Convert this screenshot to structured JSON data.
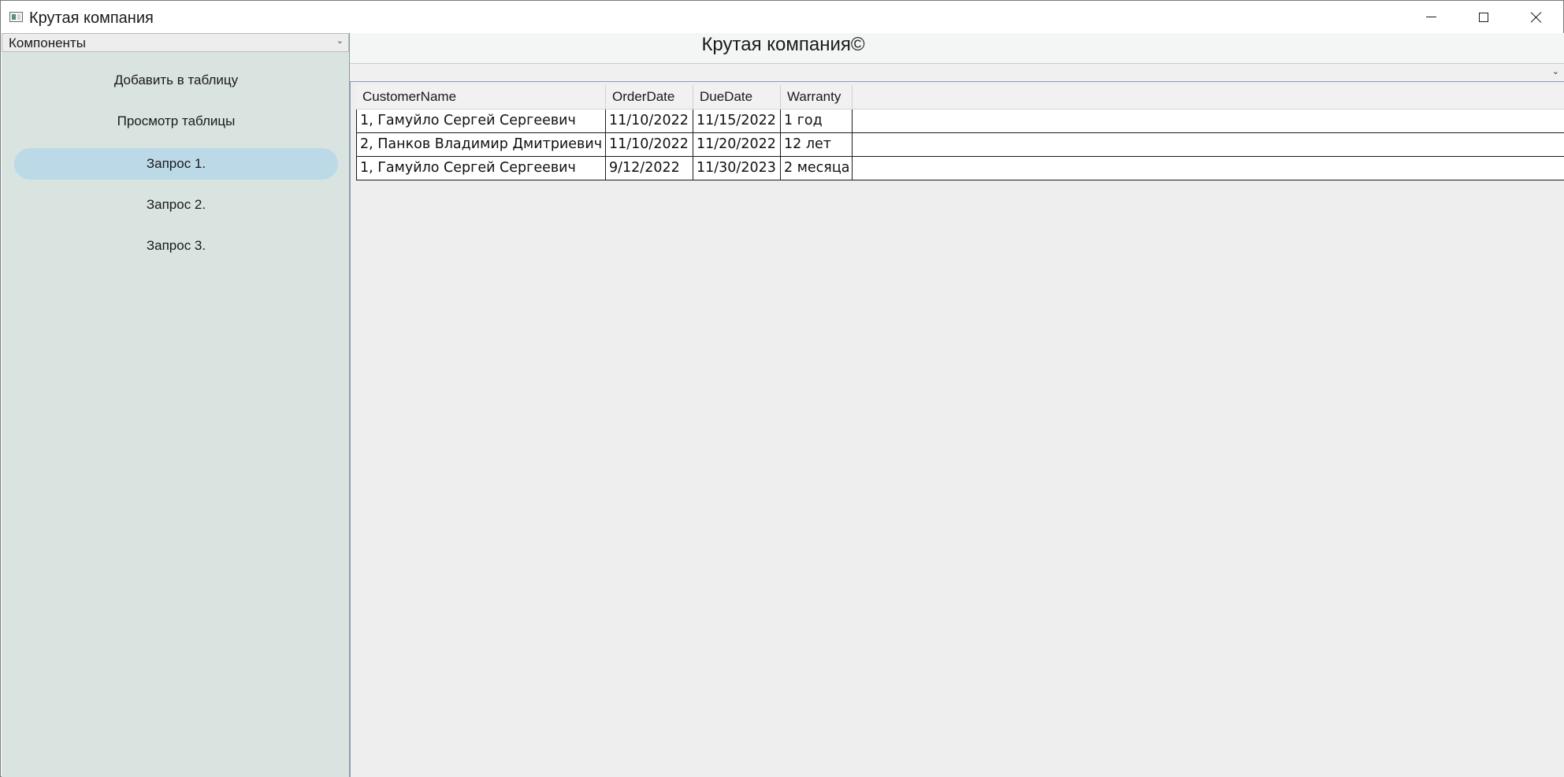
{
  "window": {
    "title": "Крутая компания"
  },
  "sidebar": {
    "selector_value": "Компоненты",
    "items": [
      {
        "label": "Добавить в таблицу"
      },
      {
        "label": "Просмотр таблицы"
      },
      {
        "label": "Запрос 1."
      },
      {
        "label": "Запрос 2."
      },
      {
        "label": "Запрос 3."
      }
    ],
    "active_index": 2
  },
  "header": {
    "title": "Крутая компания©"
  },
  "table_selector": {
    "value": ""
  },
  "grid": {
    "columns": [
      "CustomerName",
      "OrderDate",
      "DueDate",
      "Warranty"
    ],
    "rows": [
      [
        "1, Гамуйло Сергей Сергеевич",
        "11/10/2022",
        "11/15/2022",
        "1 год"
      ],
      [
        "2, Панков Владимир Дмитриевич",
        "11/10/2022",
        "11/20/2022",
        "12 лет"
      ],
      [
        "1, Гамуйло Сергей Сергеевич",
        "9/12/2022",
        "11/30/2023",
        "2 месяца"
      ]
    ]
  },
  "colors": {
    "sidebar_bg": "#d9e3e0",
    "active_item_bg": "#bcd9e8",
    "grid_bg": "#eeeeee"
  },
  "icons": {
    "app": "app-window-icon",
    "minimize": "minimize-icon",
    "maximize": "maximize-icon",
    "close": "close-icon",
    "dropdown": "chevron-down-icon"
  }
}
